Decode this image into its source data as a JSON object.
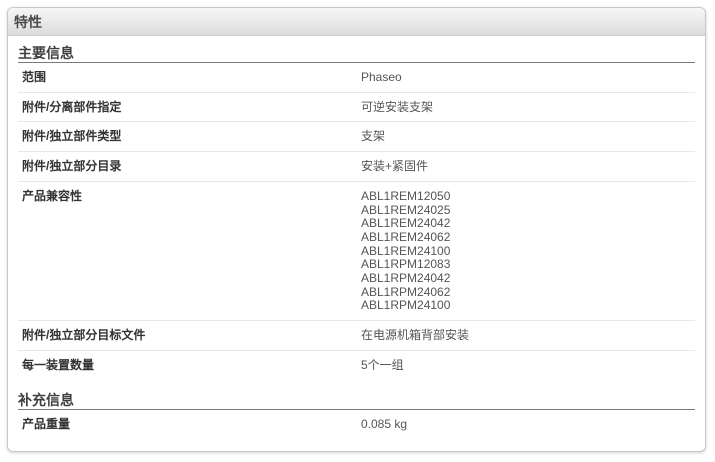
{
  "panel": {
    "title": "特性"
  },
  "main_info": {
    "title": "主要信息",
    "rows": [
      {
        "label": "范围",
        "value": "Phaseo"
      },
      {
        "label": "附件/分离部件指定",
        "value": "可逆安装支架"
      },
      {
        "label": "附件/独立部件类型",
        "value": "支架"
      },
      {
        "label": "附件/独立部分目录",
        "value": "安装+紧固件"
      }
    ],
    "compat": {
      "label": "产品兼容性",
      "values": [
        "ABL1REM12050",
        "ABL1REM24025",
        "ABL1REM24042",
        "ABL1REM24062",
        "ABL1REM24100",
        "ABL1RPM12083",
        "ABL1RPM24042",
        "ABL1RPM24062",
        "ABL1RPM24100"
      ]
    },
    "rows_after": [
      {
        "label": "附件/独立部分目标文件",
        "value": "在电源机箱背部安装"
      },
      {
        "label": "每一装置数量",
        "value": "5个一组"
      }
    ]
  },
  "supplementary_info": {
    "title": "补充信息",
    "rows": [
      {
        "label": "产品重量",
        "value": "0.085 kg"
      }
    ]
  }
}
